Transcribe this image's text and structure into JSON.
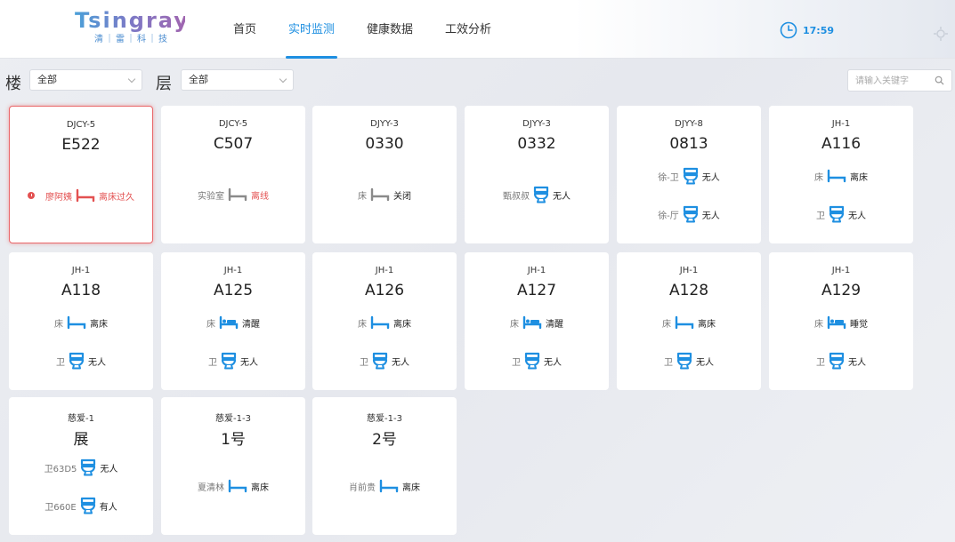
{
  "logo": {
    "main": "Tsingray",
    "sub": "清｜雷｜科｜技"
  },
  "nav": [
    "首页",
    "实时监测",
    "健康数据",
    "工效分析"
  ],
  "nav_active": 1,
  "clock": "17:59",
  "filters": {
    "building_label": "楼",
    "building_value": "全部",
    "floor_label": "层",
    "floor_value": "全部",
    "search_placeholder": "请输入关键字"
  },
  "colors": {
    "accent": "#1e8fe1",
    "alert": "#e35151",
    "icon_gray": "#8a8a8a"
  },
  "cards": [
    {
      "building": "DJCY-5",
      "room": "E522",
      "alert": true,
      "rows": [
        {
          "label": "廖阿姨",
          "icon": "bed-icon",
          "status": "离床过久",
          "red": true,
          "warn": true
        }
      ]
    },
    {
      "building": "DJCY-5",
      "room": "C507",
      "rows": [
        {
          "label": "实验室",
          "icon": "bed-off-icon",
          "status": "离线",
          "red_status": true
        }
      ]
    },
    {
      "building": "DJYY-3",
      "room": "0330",
      "rows": [
        {
          "label": "床",
          "icon": "bed-off-icon",
          "status": "关闭"
        }
      ]
    },
    {
      "building": "DJYY-3",
      "room": "0332",
      "rows": [
        {
          "label": "甄叔叔",
          "icon": "toilet-icon",
          "status": "无人"
        }
      ]
    },
    {
      "building": "DJYY-8",
      "room": "0813",
      "rows": [
        {
          "label": "徐-卫",
          "icon": "toilet-icon",
          "status": "无人"
        },
        {
          "label": "徐-厅",
          "icon": "toilet-icon",
          "status": "无人"
        }
      ]
    },
    {
      "building": "JH-1",
      "room": "A116",
      "rows": [
        {
          "label": "床",
          "icon": "bed-icon",
          "status": "离床"
        },
        {
          "label": "卫",
          "icon": "toilet-icon",
          "status": "无人"
        }
      ]
    },
    {
      "building": "JH-1",
      "room": "A118",
      "rows": [
        {
          "label": "床",
          "icon": "bed-icon",
          "status": "离床"
        },
        {
          "label": "卫",
          "icon": "toilet-icon",
          "status": "无人"
        }
      ]
    },
    {
      "building": "JH-1",
      "room": "A125",
      "rows": [
        {
          "label": "床",
          "icon": "bed-person-icon",
          "status": "清醒"
        },
        {
          "label": "卫",
          "icon": "toilet-icon",
          "status": "无人"
        }
      ]
    },
    {
      "building": "JH-1",
      "room": "A126",
      "rows": [
        {
          "label": "床",
          "icon": "bed-icon",
          "status": "离床"
        },
        {
          "label": "卫",
          "icon": "toilet-icon",
          "status": "无人"
        }
      ]
    },
    {
      "building": "JH-1",
      "room": "A127",
      "rows": [
        {
          "label": "床",
          "icon": "bed-person-icon",
          "status": "清醒"
        },
        {
          "label": "卫",
          "icon": "toilet-icon",
          "status": "无人"
        }
      ]
    },
    {
      "building": "JH-1",
      "room": "A128",
      "rows": [
        {
          "label": "床",
          "icon": "bed-icon",
          "status": "离床"
        },
        {
          "label": "卫",
          "icon": "toilet-icon",
          "status": "无人"
        }
      ]
    },
    {
      "building": "JH-1",
      "room": "A129",
      "rows": [
        {
          "label": "床",
          "icon": "bed-person-icon",
          "status": "睡觉"
        },
        {
          "label": "卫",
          "icon": "toilet-icon",
          "status": "无人"
        }
      ]
    },
    {
      "building": "慈爱-1",
      "room": "展",
      "rows": [
        {
          "label": "卫63D5",
          "icon": "toilet-icon",
          "status": "无人"
        },
        {
          "label": "卫660E",
          "icon": "toilet-icon",
          "status": "有人"
        }
      ]
    },
    {
      "building": "慈爱-1-3",
      "room": "1号",
      "rows": [
        {
          "label": "夏清林",
          "icon": "bed-icon",
          "status": "离床"
        }
      ]
    },
    {
      "building": "慈爱-1-3",
      "room": "2号",
      "rows": [
        {
          "label": "肖前贵",
          "icon": "bed-icon",
          "status": "离床"
        }
      ]
    }
  ]
}
